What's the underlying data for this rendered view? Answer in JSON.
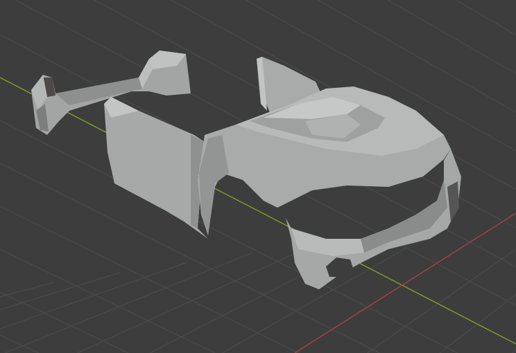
{
  "viewport": {
    "background_color": "#3d3d3d",
    "grid_color": "#4b4b4b",
    "x_axis_color": "#a0404a",
    "y_axis_color": "#7a9a2a"
  },
  "model": {
    "body_color": "#a8a9a9",
    "highlight_color": "#c4c5c5",
    "shadow_color": "#7c7d7d",
    "dark_color": "#4e4a48"
  }
}
